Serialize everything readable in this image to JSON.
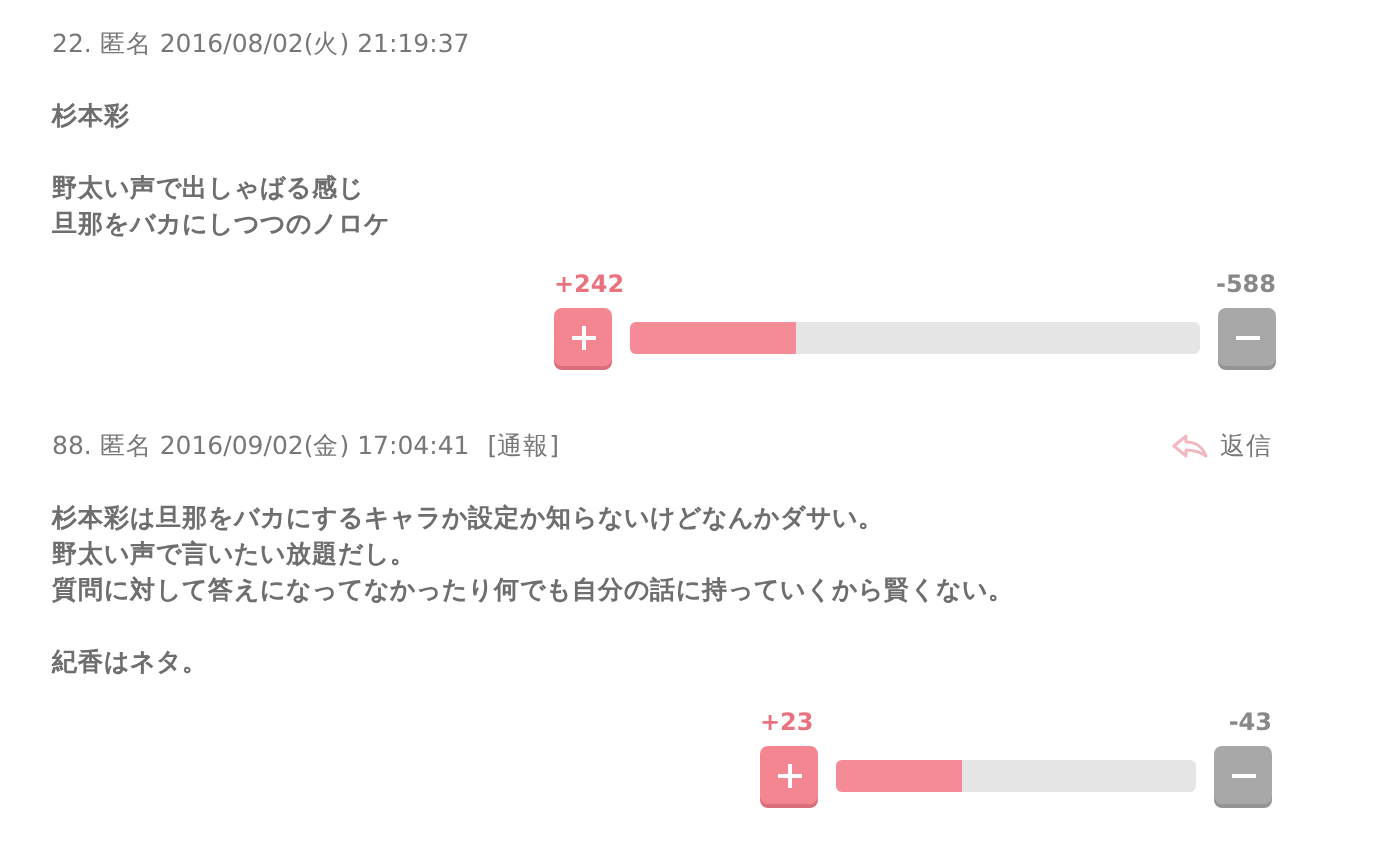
{
  "comments": [
    {
      "header": "22. 匿名 2016/08/02(火) 21:19:37",
      "paragraphs": [
        [
          "杉本彩"
        ],
        [
          "野太い声で出しゃばる感じ",
          "旦那をバカにしつつのノロケ"
        ]
      ],
      "votes": {
        "plus_label": "+242",
        "minus_label": "-588",
        "level": 0.29
      }
    },
    {
      "header": "88. 匿名 2016/09/02(金) 17:04:41",
      "report": "[通報]",
      "reply": "返信",
      "paragraphs": [
        [
          "杉本彩は旦那をバカにするキャラか設定か知らないけどなんかダサい。",
          "野太い声で言いたい放題だし。",
          "質問に対して答えになってなかったり何でも自分の話に持っていくから賢くない。"
        ],
        [
          "紀香はネタ。"
        ]
      ],
      "votes": {
        "plus_label": "+23",
        "minus_label": "-43",
        "level": 0.35
      }
    }
  ]
}
